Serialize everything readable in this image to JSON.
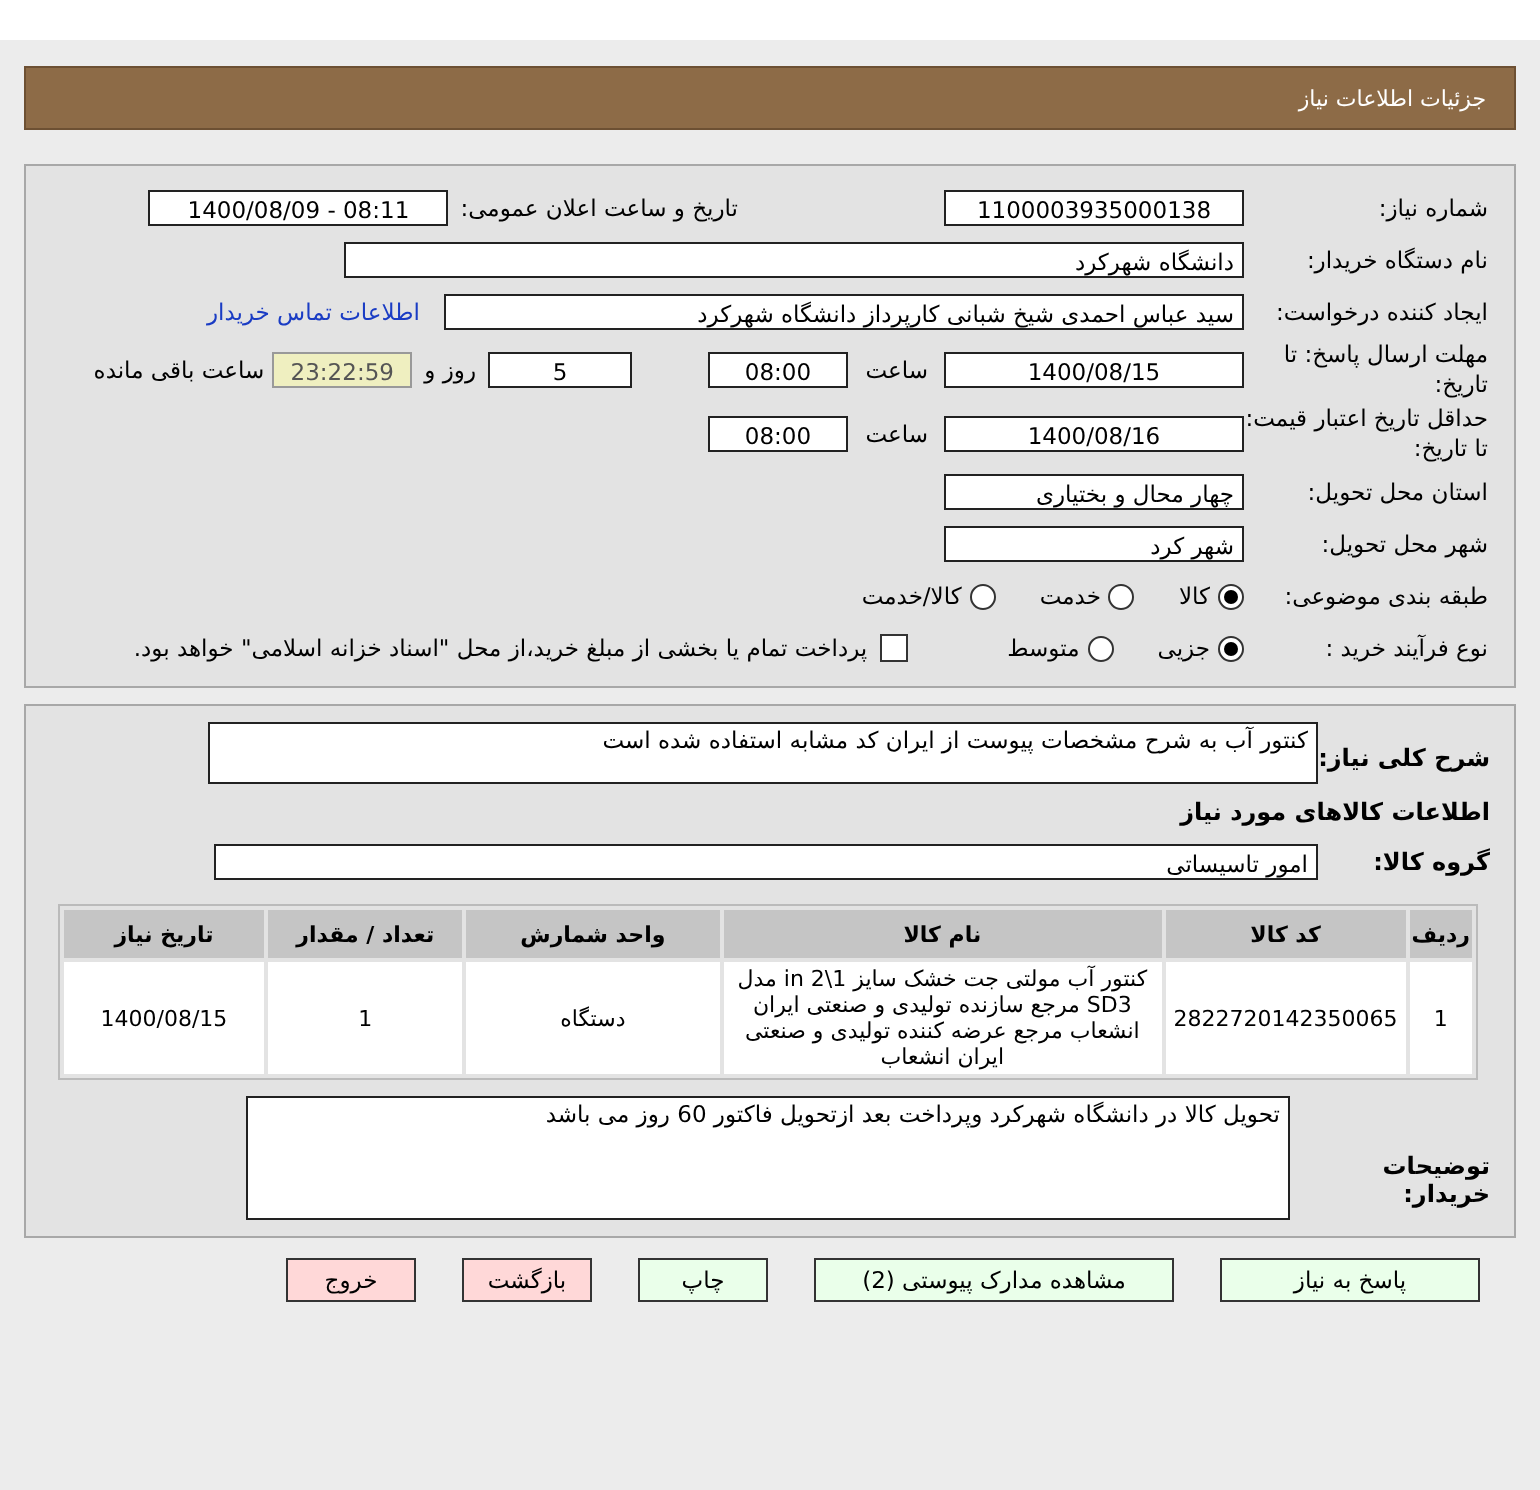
{
  "header": {
    "title": "جزئیات اطلاعات نیاز"
  },
  "need_number": {
    "label": "شماره نیاز:",
    "value": "1100003935000138"
  },
  "announce_datetime": {
    "label": "تاریخ و ساعت اعلان عمومی:",
    "value": "1400/08/09 - 08:11"
  },
  "buyer_org": {
    "label": "نام دستگاه خریدار:",
    "value": "دانشگاه شهرکرد"
  },
  "requester": {
    "label": "ایجاد کننده درخواست:",
    "value": "سید عباس احمدی شیخ شبانی کارپرداز دانشگاه شهرکرد",
    "contact_link": "اطلاعات تماس خریدار"
  },
  "response_deadline": {
    "label": "مهلت ارسال پاسخ: تا تاریخ:",
    "date": "1400/08/15",
    "time_label": "ساعت",
    "time": "08:00",
    "days": "5",
    "days_label": "روز و",
    "remaining": "23:22:59",
    "remaining_label": "ساعت باقی مانده"
  },
  "price_validity": {
    "label": "حداقل تاریخ اعتبار قیمت: تا تاریخ:",
    "date": "1400/08/16",
    "time_label": "ساعت",
    "time": "08:00"
  },
  "delivery_province": {
    "label": "استان محل تحویل:",
    "value": "چهار محال و بختیاری"
  },
  "delivery_city": {
    "label": "شهر محل تحویل:",
    "value": "شهر کرد"
  },
  "category": {
    "label": "طبقه بندی موضوعی:",
    "options": [
      {
        "label": "کالا",
        "selected": true
      },
      {
        "label": "خدمت",
        "selected": false
      },
      {
        "label": "کالا/خدمت",
        "selected": false
      }
    ]
  },
  "purchase_process": {
    "label": "نوع فرآیند خرید :",
    "options": [
      {
        "label": "جزیی",
        "selected": true
      },
      {
        "label": "متوسط",
        "selected": false
      }
    ],
    "treasury_payment": {
      "label": "پرداخت تمام یا بخشی از مبلغ خرید،از محل \"اسناد خزانه اسلامی\" خواهد بود.",
      "checked": false
    }
  },
  "general_description": {
    "label": "شرح کلی نیاز:",
    "value": "کنتور آب به شرح مشخصات پیوست از ایران کد مشابه استفاده شده است"
  },
  "goods_section_title": "اطلاعات کالاهای مورد نیاز",
  "goods_group": {
    "label": "گروه کالا:",
    "value": "امور تاسیساتی"
  },
  "table": {
    "columns": [
      "ردیف",
      "کد کالا",
      "نام کالا",
      "واحد شمارش",
      "تعداد / مقدار",
      "تاریخ نیاز"
    ],
    "rows": [
      [
        "1",
        "2822720142350065",
        "کنتور آب مولتی جت خشک سایز 1\\2 in مدل SD3 مرجع سازنده تولیدی و صنعتی ایران انشعاب مرجع عرضه کننده تولیدی و صنعتی ایران انشعاب",
        "دستگاه",
        "1",
        "1400/08/15"
      ]
    ]
  },
  "buyer_notes": {
    "label": "توضیحات خریدار:",
    "value": "تحویل کالا در دانشگاه شهرکرد وپرداخت بعد ازتحویل فاکتور 60 روز می باشد"
  },
  "buttons": [
    {
      "label": "پاسخ به نیاز",
      "kind": "normal"
    },
    {
      "label": "مشاهده مدارک پیوستی (2)",
      "kind": "normal"
    },
    {
      "label": "چاپ",
      "kind": "normal"
    },
    {
      "label": "بازگشت",
      "kind": "exit"
    },
    {
      "label": "خروج",
      "kind": "exit"
    }
  ]
}
